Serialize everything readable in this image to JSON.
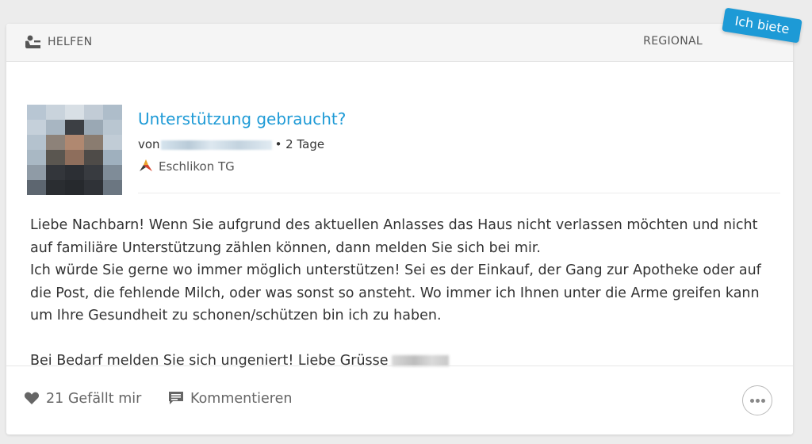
{
  "post": {
    "category_label": "HELFEN",
    "region_label": "REGIONAL",
    "ribbon_label": "Ich biete",
    "title": "Unterstützung gebraucht?",
    "byline_prefix": "von",
    "age": "• 2 Tage",
    "location": "Eschlikon TG",
    "body": [
      "Liebe Nachbarn! Wenn Sie aufgrund des aktuellen Anlasses das Haus nicht verlassen möchten und nicht auf familiäre Unterstützung zählen können, dann melden Sie sich bei mir.",
      "Ich würde Sie gerne wo immer möglich unterstützen! Sei es der Einkauf, der Gang zur Apotheke oder auf die Post, die fehlende Milch, oder was sonst so ansteht. Wo immer ich Ihnen unter die Arme greifen kann um Ihre Gesundheit zu schonen/schützen bin ich zu haben."
    ],
    "closing": "Bei Bedarf melden Sie sich ungeniert! Liebe Grüsse"
  },
  "footer": {
    "like_label": "21 Gefällt mir",
    "comment_label": "Kommentieren"
  },
  "icons": {
    "category": "person-at-desk-icon",
    "location": "community-logo-icon",
    "like": "heart-icon",
    "comment": "comment-icon",
    "more": "more-options-icon"
  },
  "colors": {
    "accent": "#1d9ad6",
    "ribbon": "#1d9ad6",
    "background": "#ececec",
    "card": "#ffffff"
  }
}
